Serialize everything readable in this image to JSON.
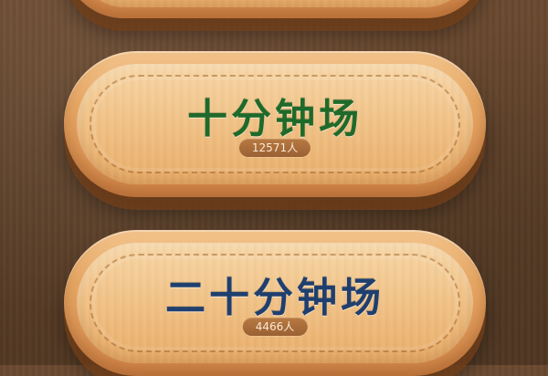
{
  "rooms": [
    {
      "title": "十分钟场",
      "players": "12571人",
      "title_color": "#1f6a2a"
    },
    {
      "title": "二十分钟场",
      "players": "4466人",
      "title_color": "#1f3f6e"
    }
  ],
  "colors": {
    "background_wood": "#5b3f28",
    "button_wood": "#e7a865",
    "badge": "#8c5228"
  }
}
